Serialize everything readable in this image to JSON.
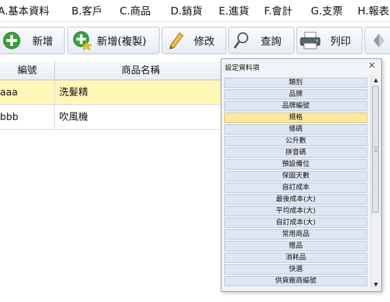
{
  "menu": {
    "items": [
      {
        "label": "A.基本資料"
      },
      {
        "label": "B.客戶"
      },
      {
        "label": "C.商品"
      },
      {
        "label": "D.銷貨"
      },
      {
        "label": "E.進貨"
      },
      {
        "label": "F.會計"
      },
      {
        "label": "G.支票"
      },
      {
        "label": "H.報表"
      }
    ]
  },
  "toolbar": {
    "add_label": "新增",
    "add_copy_label": "新增(複製)",
    "edit_label": "修改",
    "query_label": "查詢",
    "print_label": "列印"
  },
  "table": {
    "columns": [
      "編號",
      "商品名稱"
    ],
    "rows": [
      {
        "id": "aaa",
        "name": "洗髮精"
      },
      {
        "id": "bbb",
        "name": "吹風機"
      }
    ]
  },
  "popup": {
    "title": "設定資料項",
    "close": "×",
    "selected_item": "規格",
    "items": [
      "類別",
      "品牌",
      "品牌編號",
      "規格",
      "條碼",
      "公升數",
      "拼音碼",
      "預設備位",
      "保固天數",
      "自訂成本",
      "最後成本(大)",
      "平均成本(大)",
      "自訂成本(大)",
      "常用商品",
      "贈品",
      "消耗品",
      "快選",
      "供貨廠商編號"
    ],
    "scroll_up": "▲",
    "scroll_down": "▼"
  },
  "colors": {
    "selected_row": "#fff7b8",
    "list_item": "#dde6f2",
    "selected_item": "#fbe9a3"
  },
  "icons": {
    "add": "plus-circle-icon",
    "add_copy": "plus-star-icon",
    "edit": "pencil-icon",
    "query": "magnifier-icon",
    "print": "printer-icon",
    "next": "arrow-icon"
  }
}
